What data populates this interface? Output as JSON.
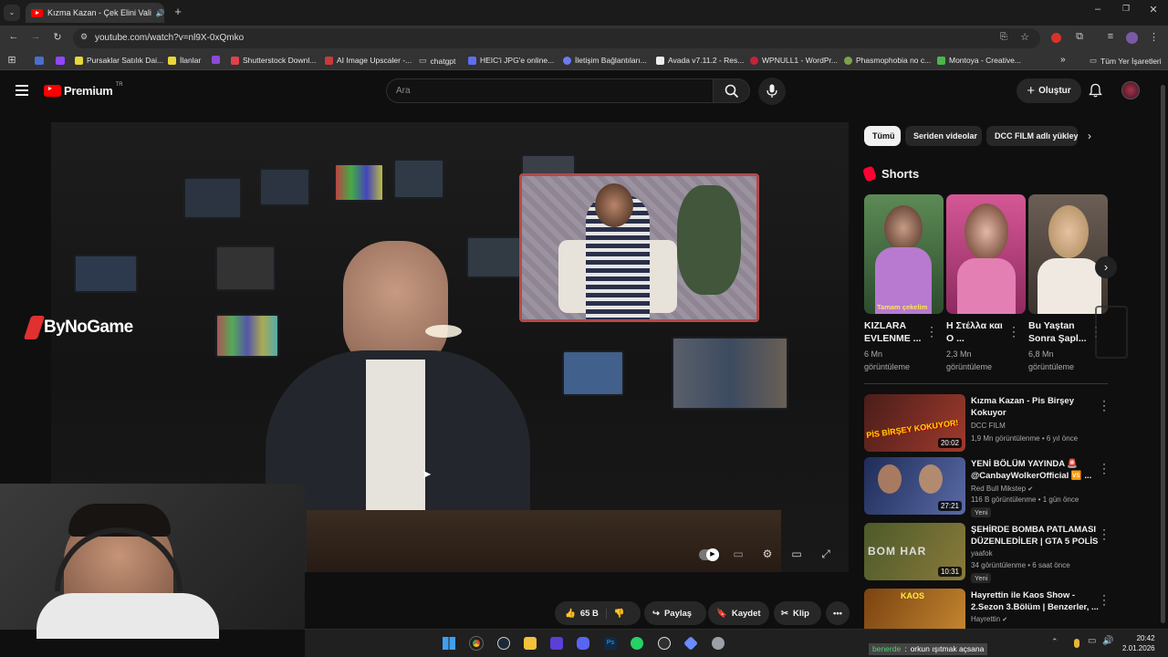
{
  "browser": {
    "tab_title": "Kızma Kazan - Çek Elini Vali",
    "url": "youtube.com/watch?v=nl9X-0xQmko",
    "bookmarks": [
      "Pursaklar Satılık Dai...",
      "İlanlar",
      "Shutterstock Downl...",
      "AI Image Upscaler -...",
      "chatgpt",
      "HEIC'i JPG'e online...",
      "İletişim Bağlantıları...",
      "Avada v7.11.2 - Res...",
      "WPNULL1 - WordPr...",
      "Phasmophobia no c...",
      "Montoya - Creative..."
    ],
    "all_bookmarks": "Tüm Yer İşaretleri"
  },
  "youtube": {
    "logo_text": "Premium",
    "logo_sup": "TR",
    "search_placeholder": "Ara",
    "create_label": "Oluştur",
    "overlay_brand": "ByNoGame"
  },
  "chips": [
    "Tümü",
    "Seriden videolar",
    "DCC FILM adlı yükleyici"
  ],
  "shorts": {
    "heading": "Shorts",
    "items": [
      {
        "title": "KIZLARA EVLENME ...",
        "views": "6 Mn",
        "unit": "görüntüleme",
        "caption": "Tamam çekelim",
        "color": "#3d6a3e"
      },
      {
        "title": "Η Στέλλα και Ο ...",
        "views": "2,3 Mn",
        "unit": "görüntüleme",
        "caption": "",
        "color": "#c3447f"
      },
      {
        "title": "Bu Yaştan Sonra Şapl...",
        "views": "6,8 Mn",
        "unit": "görüntüleme",
        "caption": "",
        "color": "#c9a98b"
      }
    ]
  },
  "recommendations": [
    {
      "title": "Kızma Kazan - Pis Birşey Kokuyor",
      "channel": "DCC FILM",
      "meta": "1,9 Mn görüntülenme • 6 yıl önce",
      "duration": "20:02",
      "badge": "",
      "thumb_text": "PİS BİRŞEY KOKUYOR!",
      "color": "#6b2a24"
    },
    {
      "title": "YENİ BÖLÜM YAYINDA 🚨 @CanbayWolkerOfficial 🆚 ...",
      "channel": "Red Bull Mikstep",
      "meta": "116 B görüntülenme • 1 gün önce",
      "duration": "27:21",
      "badge": "Yeni",
      "thumb_text": "",
      "color": "#2b3a6b"
    },
    {
      "title": "ŞEHİRDE BOMBA PATLAMASI DÜZENLEDİLER | GTA 5 POLİS ...",
      "channel": "yaafok",
      "meta": "34 görüntülenme • 6 saat önce",
      "duration": "10:31",
      "badge": "Yeni",
      "thumb_text": "BOM HAR",
      "color": "#5a5f30"
    },
    {
      "title": "Hayrettin ile Kaos Show - 2.Sezon 3.Bölüm | Benzerler, ...",
      "channel": "Hayrettin",
      "meta": "",
      "duration": "",
      "badge": "",
      "thumb_text": "KAOS",
      "color": "#7a4a18"
    }
  ],
  "actions": {
    "likes": "65 B",
    "share": "Paylaş",
    "save": "Kaydet",
    "clip": "Klip"
  },
  "taskbar": {
    "notification": "orkun ışıtmak açsana",
    "notification_user": "benerde",
    "time": "20:42",
    "date": "2.01.2026"
  }
}
